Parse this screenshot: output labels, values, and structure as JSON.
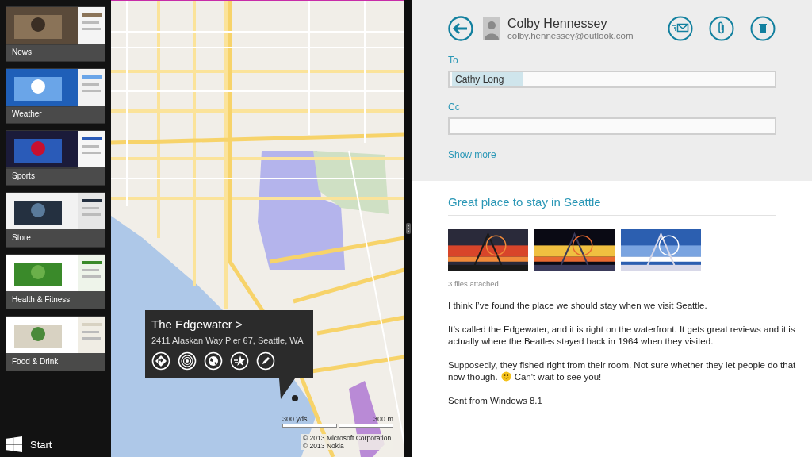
{
  "app_switcher": {
    "apps": [
      {
        "label": "News"
      },
      {
        "label": "Weather"
      },
      {
        "label": "Sports"
      },
      {
        "label": "Store"
      },
      {
        "label": "Health & Fitness"
      },
      {
        "label": "Food & Drink"
      }
    ],
    "start_label": "Start"
  },
  "map": {
    "place_card": {
      "title": "The Edgewater",
      "chevron": ">",
      "address": "2411 Alaskan Way Pier 67, Seattle, WA"
    },
    "scale": {
      "imperial": "300 yds",
      "metric": "300 m"
    },
    "copyright": [
      "© 2013 Microsoft Corporation",
      "© 2013 Nokia"
    ]
  },
  "mail": {
    "sender": {
      "name": "Colby Hennessey",
      "email": "colby.hennessey@outlook.com"
    },
    "to": {
      "label": "To",
      "recipients": [
        "Cathy Long"
      ]
    },
    "cc": {
      "label": "Cc"
    },
    "show_more": "Show more",
    "subject": "Great place to stay in Seattle",
    "attachments_note": "3 files attached",
    "body": [
      {
        "kind": "text",
        "text": "I think I’ve found the place we should stay when we visit Seattle."
      },
      {
        "kind": "text",
        "text": "It’s called the Edgewater, and it is right on the waterfront. It gets great reviews and it is actually where the Beatles stayed back in 1964 when they visited."
      },
      {
        "kind": "smiley",
        "first_line": "Supposedly, they fished right from their room. Not sure whether they let people do that",
        "before": "now though.",
        "after": "Can't wait to see you!"
      },
      {
        "kind": "text",
        "text": "Sent from Windows 8.1"
      }
    ]
  }
}
